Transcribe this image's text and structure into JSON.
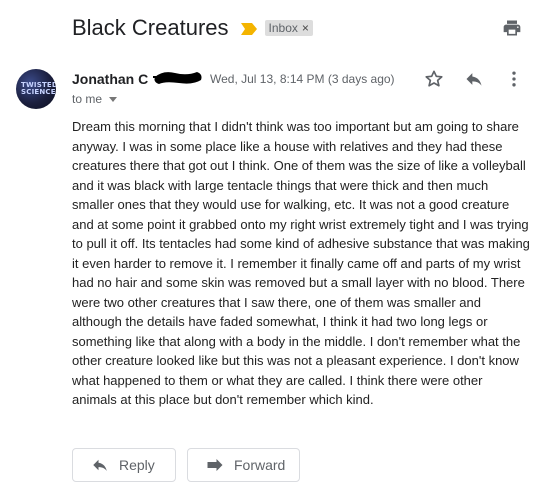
{
  "thread": {
    "subject": "Black Creatures",
    "label": "Inbox",
    "label_close": "×",
    "print_icon": "print-icon",
    "importance_color": "#f4b400"
  },
  "message": {
    "sender": "Jonathan C",
    "avatar_text": "TWISTED SCIENCE",
    "date": "Wed, Jul 13, 8:14 PM (3 days ago)",
    "to": "to me",
    "body": "Dream this morning that I didn't think was too important but am going to share anyway. I was in some place like a house with relatives and they had these creatures there that got out I think. One of them was the size of like a volleyball and it was black with large tentacle things that were thick and then much smaller ones that they would use for walking, etc. It was not a good creature and at some point it grabbed onto my right wrist extremely tight and I was trying to pull it off. Its tentacles had some kind of adhesive substance that was making it even harder to remove it. I remember it finally came off and parts of my wrist had no hair and some skin was removed but a small layer with no blood. There were two other creatures that I saw there, one of them was smaller and although the details have faded somewhat, I think it had two long legs or something like that along with a body in the middle. I don't remember what the other creature looked like but this was not a pleasant experience. I don't know what happened to them or what they are called. I think there were other animals at this place but don't remember which kind."
  },
  "actions": {
    "reply_label": "Reply",
    "forward_label": "Forward"
  }
}
